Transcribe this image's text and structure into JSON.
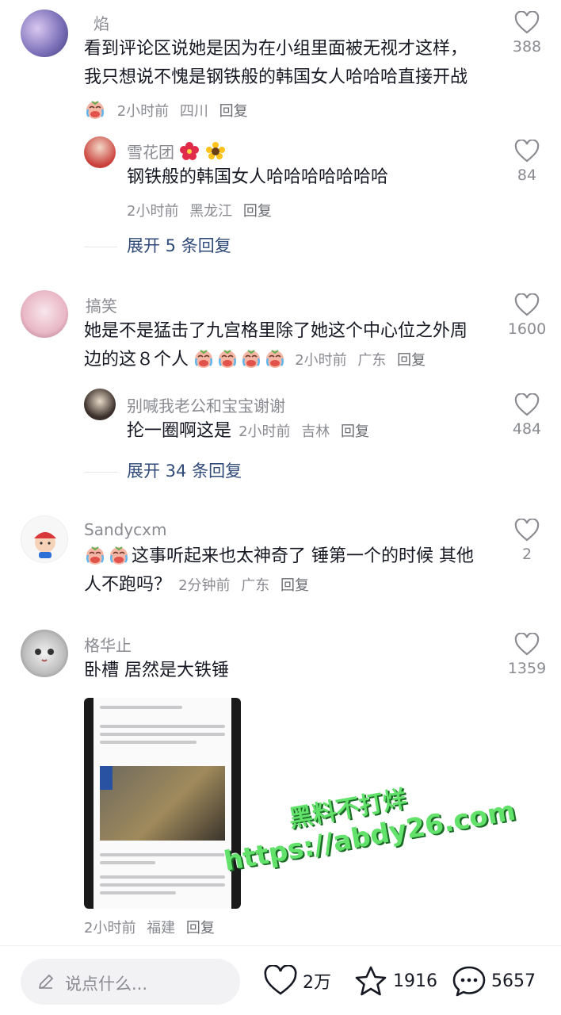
{
  "comments": [
    {
      "username": "焰",
      "text_line1": "看到评论区说她是因为在小组里面被无视才这样，",
      "text_line2": "我只想说不愧是钢铁般的韩国女人哈哈哈直接开战",
      "time": "2小时前",
      "location": "四川",
      "reply_label": "回复",
      "likes": "388",
      "replies": [
        {
          "username": "雪花团",
          "text": "钢铁般的韩国女人哈哈哈哈哈哈哈",
          "time": "2小时前",
          "location": "黑龙江",
          "reply_label": "回复",
          "likes": "84"
        }
      ],
      "expand_label": "展开 5 条回复"
    },
    {
      "username": "搞笑",
      "text_line1": "她是不是猛击了九宫格里除了她这个中心位之外周",
      "text_line2": "边的这８个人",
      "time": "2小时前",
      "location": "广东",
      "reply_label": "回复",
      "likes": "1600",
      "replies": [
        {
          "username": "别喊我老公和宝宝谢谢",
          "text": "抡一圈啊这是",
          "time": "2小时前",
          "location": "吉林",
          "reply_label": "回复",
          "likes": "484"
        }
      ],
      "expand_label": "展开 34 条回复"
    },
    {
      "username": "Sandycxm",
      "text_line1": "这事听起来也太神奇了 锤第一个的时候 其他",
      "text_line2": "人不跑吗？",
      "time": "2分钟前",
      "location": "广东",
      "reply_label": "回复",
      "likes": "2"
    },
    {
      "username": "格华止",
      "text_line1": "卧槽 居然是大铁锤",
      "time": "2小时前",
      "location": "福建",
      "reply_label": "回复",
      "likes": "1359"
    }
  ],
  "watermark": {
    "line1": "黑料不打烊",
    "line2": "https://abdy26.com"
  },
  "bottom_bar": {
    "input_placeholder": "说点什么...",
    "likes": "2万",
    "favorites": "1916",
    "comments": "5657"
  },
  "colors": {
    "link": "#2f4a78",
    "meta": "#8a8b91",
    "watermark": "#62e26a"
  }
}
